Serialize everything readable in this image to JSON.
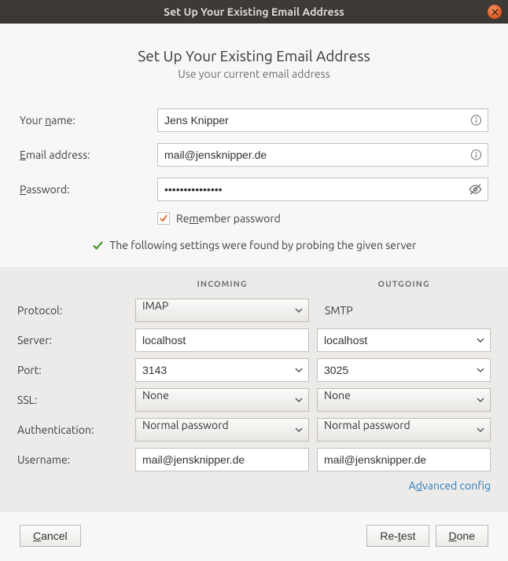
{
  "window": {
    "title": "Set Up Your Existing Email Address"
  },
  "header": {
    "title": "Set Up Your Existing Email Address",
    "subtitle": "Use your current email address"
  },
  "form": {
    "name_label_pre": "Your ",
    "name_label_u": "n",
    "name_label_post": "ame:",
    "name_value": "Jens Knipper",
    "email_label_u": "E",
    "email_label_post": "mail address:",
    "email_value": "mail@jensknipper.de",
    "pass_label_u": "P",
    "pass_label_post": "assword:",
    "pass_value": "•••••••••••••••",
    "remember_pre": "Re",
    "remember_u": "m",
    "remember_post": "ember password",
    "remember_checked": true
  },
  "status": {
    "text": "The following settings were found by probing the given server"
  },
  "server": {
    "col_in": "Incoming",
    "col_out": "Outgoing",
    "protocol_label": "Protocol:",
    "protocol_in": "IMAP",
    "protocol_out": "SMTP",
    "server_label": "Server:",
    "server_in": "localhost",
    "server_out": "localhost",
    "port_label": "Port:",
    "port_in": "3143",
    "port_out": "3025",
    "ssl_label": "SSL:",
    "ssl_in": "None",
    "ssl_out": "None",
    "auth_label": "Authentication:",
    "auth_in": "Normal password",
    "auth_out": "Normal password",
    "user_label": "Username:",
    "user_in": "mail@jensknipper.de",
    "user_out": "mail@jensknipper.de",
    "advanced_pre": "A",
    "advanced_u": "d",
    "advanced_post": "vanced config"
  },
  "buttons": {
    "cancel_u": "C",
    "cancel_post": "ancel",
    "retest_pre": "Re-",
    "retest_u": "t",
    "retest_post": "est",
    "done_u": "D",
    "done_post": "one"
  }
}
